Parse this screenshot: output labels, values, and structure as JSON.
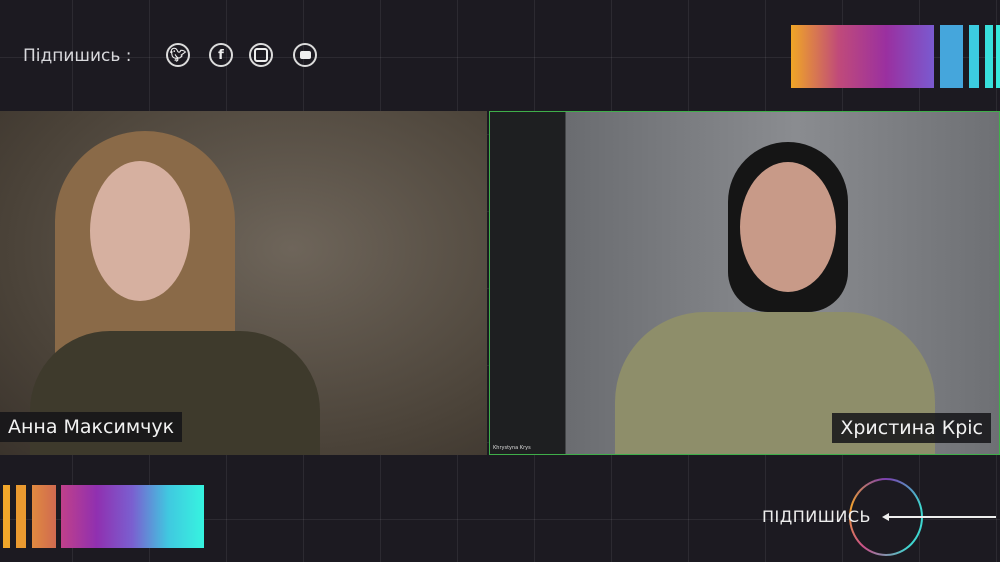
{
  "header": {
    "subscribe_label": "Підпишись :",
    "social_icons": [
      "twitter-icon",
      "facebook-icon",
      "instagram-icon",
      "youtube-icon"
    ]
  },
  "participants": [
    {
      "display_name": "Анна Максимчук"
    },
    {
      "display_name": "Христина Кріс",
      "tile_label": "Khrystyna Krys"
    }
  ],
  "footer": {
    "subscribe_label": "ПІДПИШИСЬ"
  },
  "colors": {
    "background": "#1c1a21",
    "active_speaker_border": "#3fae4a",
    "gradient": [
      "#f0a62a",
      "#a0309a",
      "#36f0e0"
    ]
  }
}
